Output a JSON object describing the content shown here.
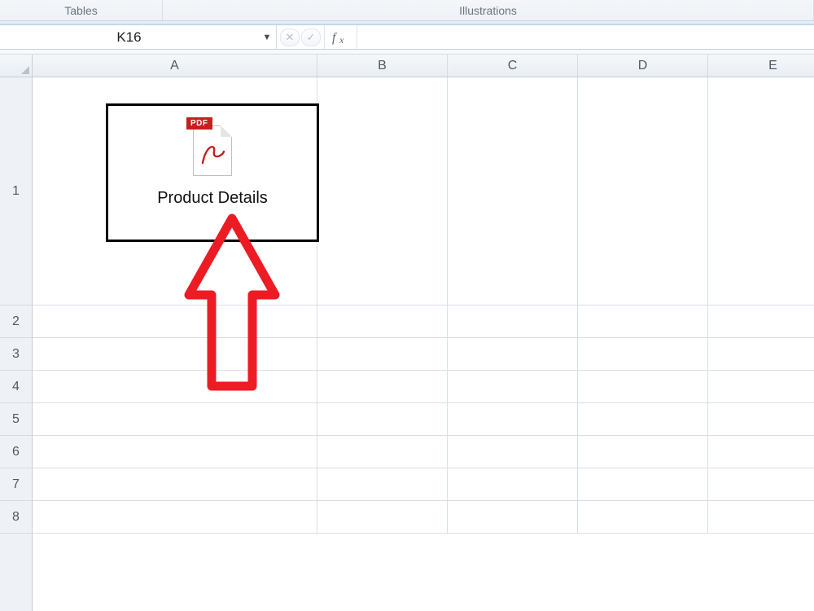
{
  "ribbon": {
    "groups": {
      "tables": "Tables",
      "illustrations": "Illustrations"
    }
  },
  "namebox": {
    "value": "K16"
  },
  "formula": {
    "fx_label": "fx",
    "value": ""
  },
  "columns": [
    "A",
    "B",
    "C",
    "D",
    "E"
  ],
  "rows": [
    "1",
    "2",
    "3",
    "4",
    "5",
    "6",
    "7",
    "8"
  ],
  "embedded_object": {
    "badge": "PDF",
    "label": "Product Details"
  },
  "colors": {
    "annotation_red": "#ed1c24",
    "pdf_red": "#c4201e"
  }
}
